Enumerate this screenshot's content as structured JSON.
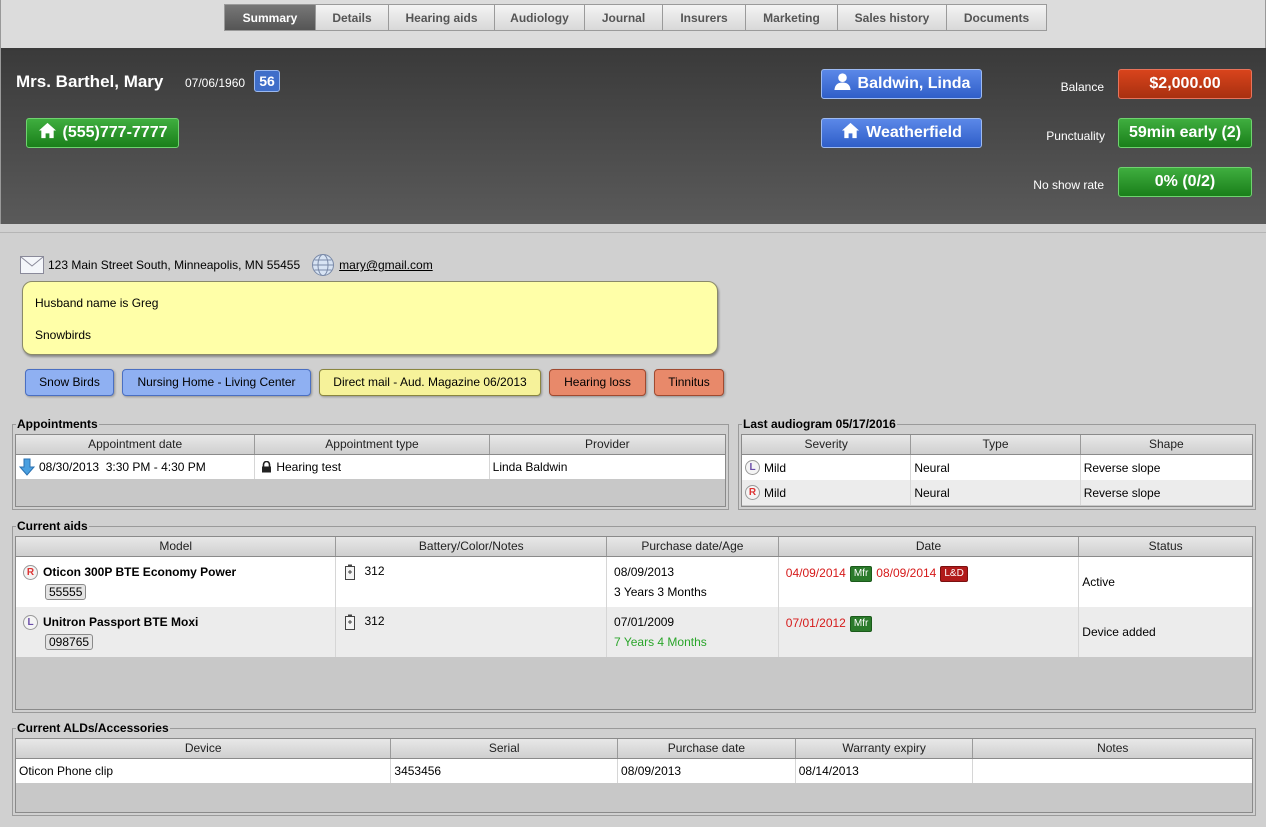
{
  "tabs": [
    {
      "label": "Summary",
      "active": true
    },
    {
      "label": "Details"
    },
    {
      "label": "Hearing aids"
    },
    {
      "label": "Audiology"
    },
    {
      "label": "Journal"
    },
    {
      "label": "Insurers"
    },
    {
      "label": "Marketing"
    },
    {
      "label": "Sales history"
    },
    {
      "label": "Documents"
    }
  ],
  "header": {
    "patient_name": "Mrs. Barthel, Mary",
    "dob": "07/06/1960",
    "age": "56",
    "phone": "(555)777-7777",
    "provider": "Baldwin, Linda",
    "location": "Weatherfield",
    "balance_label": "Balance",
    "balance_value": "$2,000.00",
    "punctuality_label": "Punctuality",
    "punctuality_value": "59min early (2)",
    "noshow_label": "No show rate",
    "noshow_value": "0% (0/2)"
  },
  "contact": {
    "address": "123 Main Street South, Minneapolis, MN 55455",
    "email": "mary@gmail.com"
  },
  "notes": [
    "Husband name is Greg",
    "Snowbirds"
  ],
  "tags": [
    {
      "label": "Snow Birds",
      "color": "blue"
    },
    {
      "label": "Nursing Home - Living Center",
      "color": "blue"
    },
    {
      "label": "Direct mail - Aud. Magazine 06/2013",
      "color": "yellow"
    },
    {
      "label": "Hearing loss",
      "color": "salmon"
    },
    {
      "label": "Tinnitus",
      "color": "salmon"
    }
  ],
  "appointments": {
    "title": "Appointments",
    "columns": [
      "Appointment date",
      "Appointment type",
      "Provider"
    ],
    "rows": [
      {
        "date": "08/30/2013  3:30 PM - 4:30 PM",
        "type": "Hearing test",
        "provider": "Linda Baldwin"
      }
    ]
  },
  "audiogram": {
    "title": "Last audiogram 05/17/2016",
    "columns": [
      "Severity",
      "Type",
      "Shape"
    ],
    "rows": [
      {
        "ear": "L",
        "severity": "Mild",
        "type": "Neural",
        "shape": "Reverse slope"
      },
      {
        "ear": "R",
        "severity": "Mild",
        "type": "Neural",
        "shape": "Reverse slope"
      }
    ]
  },
  "aids": {
    "title": "Current aids",
    "columns": [
      "Model",
      "Battery/Color/Notes",
      "Purchase date/Age",
      "Date",
      "Status"
    ],
    "rows": [
      {
        "ear": "R",
        "model": "Oticon 300P BTE Economy Power",
        "serial": "55555",
        "battery": "312",
        "purchase_date": "08/09/2013",
        "age": "3 Years 3 Months",
        "date1": "04/09/2014",
        "badge1": "Mfr",
        "date2": "08/09/2014",
        "badge2": "L&D",
        "status": "Active"
      },
      {
        "ear": "L",
        "model": "Unitron Passport BTE Moxi",
        "serial": "098765",
        "battery": "312",
        "purchase_date": "07/01/2009",
        "age": "7 Years 4 Months",
        "date1": "07/01/2012",
        "badge1": "Mfr",
        "status": "Device added"
      }
    ]
  },
  "alds": {
    "title": "Current ALDs/Accessories",
    "columns": [
      "Device",
      "Serial",
      "Purchase date",
      "Warranty expiry",
      "Notes"
    ],
    "rows": [
      {
        "device": "Oticon Phone clip",
        "serial": "3453456",
        "purchase_date": "08/09/2013",
        "warranty": "08/14/2013",
        "notes": ""
      }
    ]
  },
  "colors": {
    "header_bg": "#4a4a4a",
    "green_btn": "#2e962e",
    "blue_btn": "#3f6ec9",
    "orange_btn": "#c23a16",
    "note_bg": "#ffffa8"
  }
}
